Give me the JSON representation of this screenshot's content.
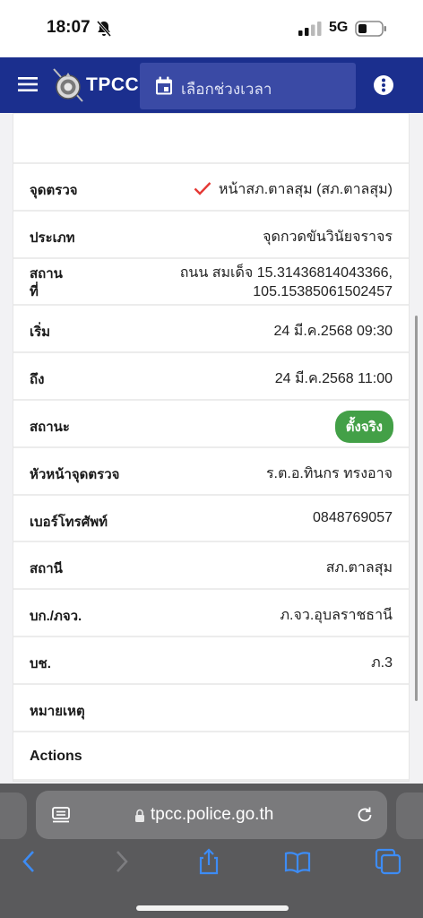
{
  "status_bar": {
    "time": "18:07",
    "network": "5G",
    "silent_icon": "bell-slash-icon",
    "signal_icon": "cellular-signal-icon",
    "battery_icon": "battery-icon"
  },
  "app_bar": {
    "brand": "TPCC",
    "date_range_placeholder": "เลือกช่วงเวลา",
    "menu_icon": "hamburger-menu-icon",
    "more_icon": "more-vertical-icon",
    "calendar_icon": "calendar-icon",
    "color": "#1b2f8e"
  },
  "detail": {
    "rows": [
      {
        "label": "จุดตรวจ",
        "value": "หน้าสภ.ตาลสุม (สภ.ตาลสุม)"
      },
      {
        "label": "ประเภท",
        "value": "จุดกวดขันวินัยจราจร"
      },
      {
        "label_line1": "สถาน",
        "label_line2": "ที่",
        "value_line1": "ถนน สมเด็จ 15.31436814043366,",
        "value_line2": "105.15385061502457"
      },
      {
        "label": "เริ่ม",
        "value": "24 มี.ค.2568 09:30"
      },
      {
        "label": "ถึง",
        "value": "24 มี.ค.2568 11:00"
      },
      {
        "label": "สถานะ",
        "value": "ตั้งจริง"
      },
      {
        "label": "หัวหน้าจุดตรวจ",
        "value": "ร.ต.อ.ทินกร ทรงอาจ"
      },
      {
        "label": "เบอร์โทรศัพท์",
        "value": "0848769057"
      },
      {
        "label": "สถานี",
        "value": "สภ.ตาลสุม"
      },
      {
        "label": "บก./ภจว.",
        "value": "ภ.จว.อุบลราชธานี"
      },
      {
        "label": "บช.",
        "value": "ภ.3"
      },
      {
        "label": "หมายเหตุ",
        "value": ""
      }
    ],
    "actions_label": "Actions",
    "status_color": "#43a047",
    "check_color": "#e53935"
  },
  "browser": {
    "url": "tpcc.police.go.th",
    "reader_icon": "page-menu-icon",
    "lock_icon": "lock-icon",
    "reload_icon": "reload-icon",
    "toolbar_icons": [
      "back-icon",
      "forward-icon",
      "share-icon",
      "bookmarks-icon",
      "tabs-icon"
    ]
  }
}
